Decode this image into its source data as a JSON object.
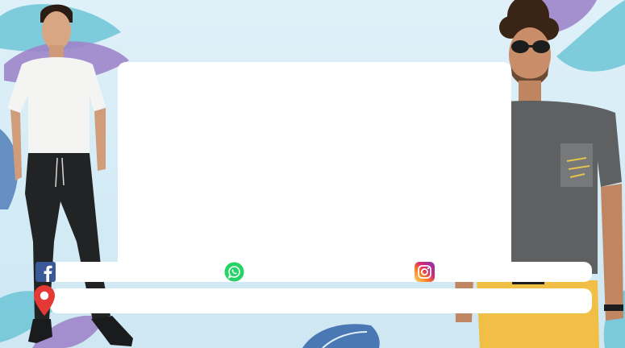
{
  "banner": {
    "background_color": "#dff0f8",
    "card_text": ""
  },
  "contacts": {
    "facebook": {
      "icon": "facebook-icon",
      "value": ""
    },
    "whatsapp": {
      "icon": "whatsapp-icon",
      "value": ""
    },
    "instagram": {
      "icon": "instagram-icon",
      "value": ""
    },
    "address": {
      "icon": "location-pin-icon",
      "value": ""
    }
  },
  "colors": {
    "facebook": "#3b5998",
    "whatsapp": "#25d366",
    "instagram_start": "#feda75",
    "instagram_end": "#8134af",
    "location": "#e53935",
    "leaf_purple": "#9d85c9",
    "leaf_teal": "#6cc4d6",
    "leaf_blue": "#4a78b5"
  }
}
